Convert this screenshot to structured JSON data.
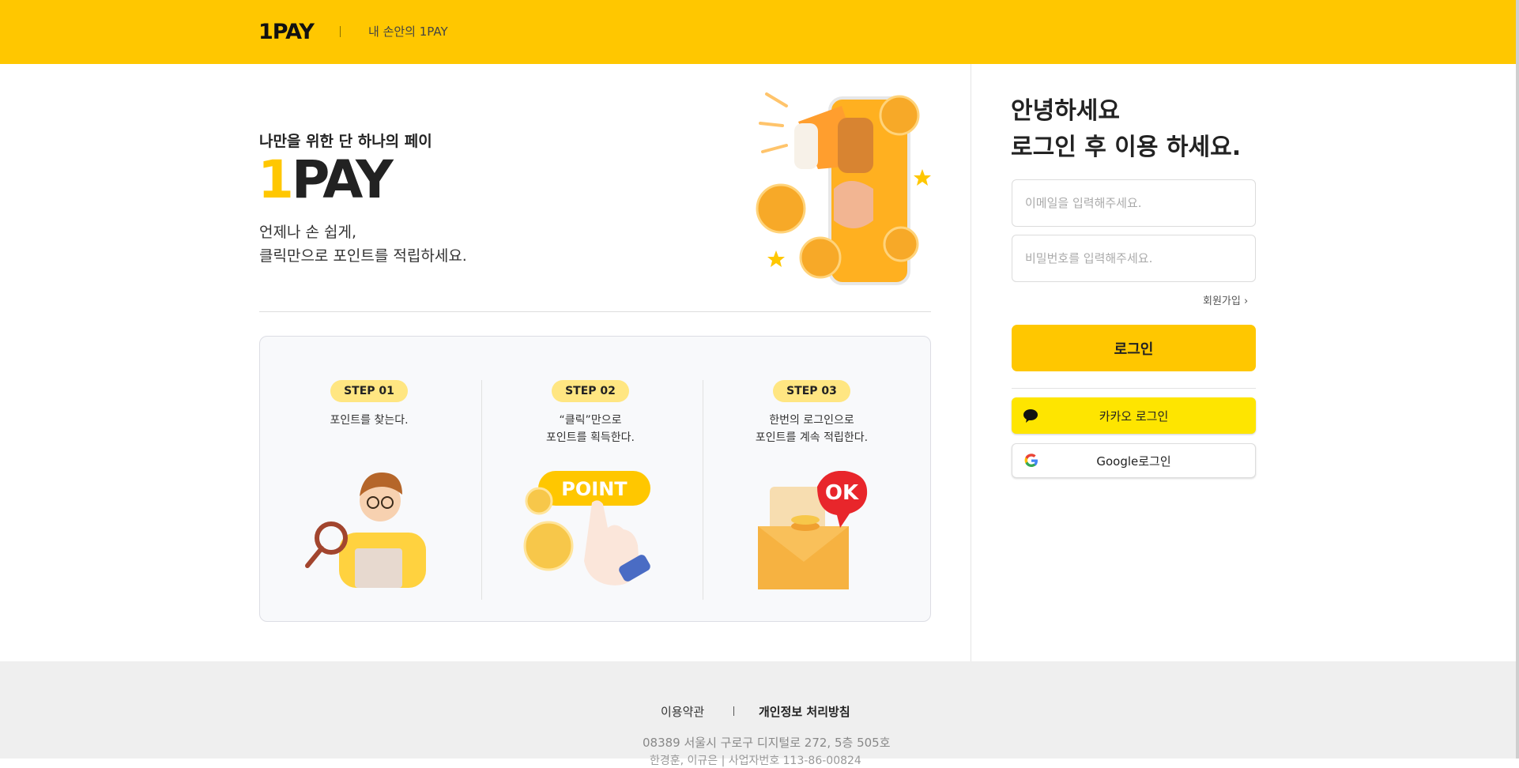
{
  "header": {
    "logo": "1PAY",
    "tagline": "내 손안의 1PAY",
    "brand_color": "#FFC700"
  },
  "hero": {
    "subtitle": "나만을 위한 단 하나의 페이",
    "title_accent": "1",
    "title_rest": "PAY",
    "desc_line1": "언제나 손 쉽게,",
    "desc_line2": "클릭만으로 포인트를 적립하세요."
  },
  "steps": [
    {
      "badge": "STEP 01",
      "line1": "포인트를 찾는다.",
      "line2": "",
      "illustration": "person-magnifier-laptop"
    },
    {
      "badge": "STEP 02",
      "line1": "“클릭”만으로",
      "line2": "포인트를 획득한다.",
      "illustration": "hand-point-coins",
      "point_label": "POINT"
    },
    {
      "badge": "STEP 03",
      "line1": "한번의 로그인으로",
      "line2": "포인트를 계속 적립한다.",
      "illustration": "envelope-ok",
      "ok_label": "OK"
    }
  ],
  "login": {
    "greeting_line1": "안녕하세요",
    "greeting_line2": "로그인 후 이용 하세요.",
    "email_placeholder": "이메일을 입력해주세요.",
    "password_placeholder": "비밀번호를 입력해주세요.",
    "signup_label": "회원가입 ›",
    "login_button": "로그인",
    "kakao_button": "카카오 로그인",
    "google_button": "Google로그인",
    "kakao_color": "#FEE500"
  },
  "footer": {
    "terms": "이용약관",
    "privacy": "개인정보 처리방침",
    "address": "08389 서울시 구로구 디지털로 272, 5층 505호",
    "cut_line": "한경훈, 이규은 | 사업자번호 113-86-00824"
  }
}
